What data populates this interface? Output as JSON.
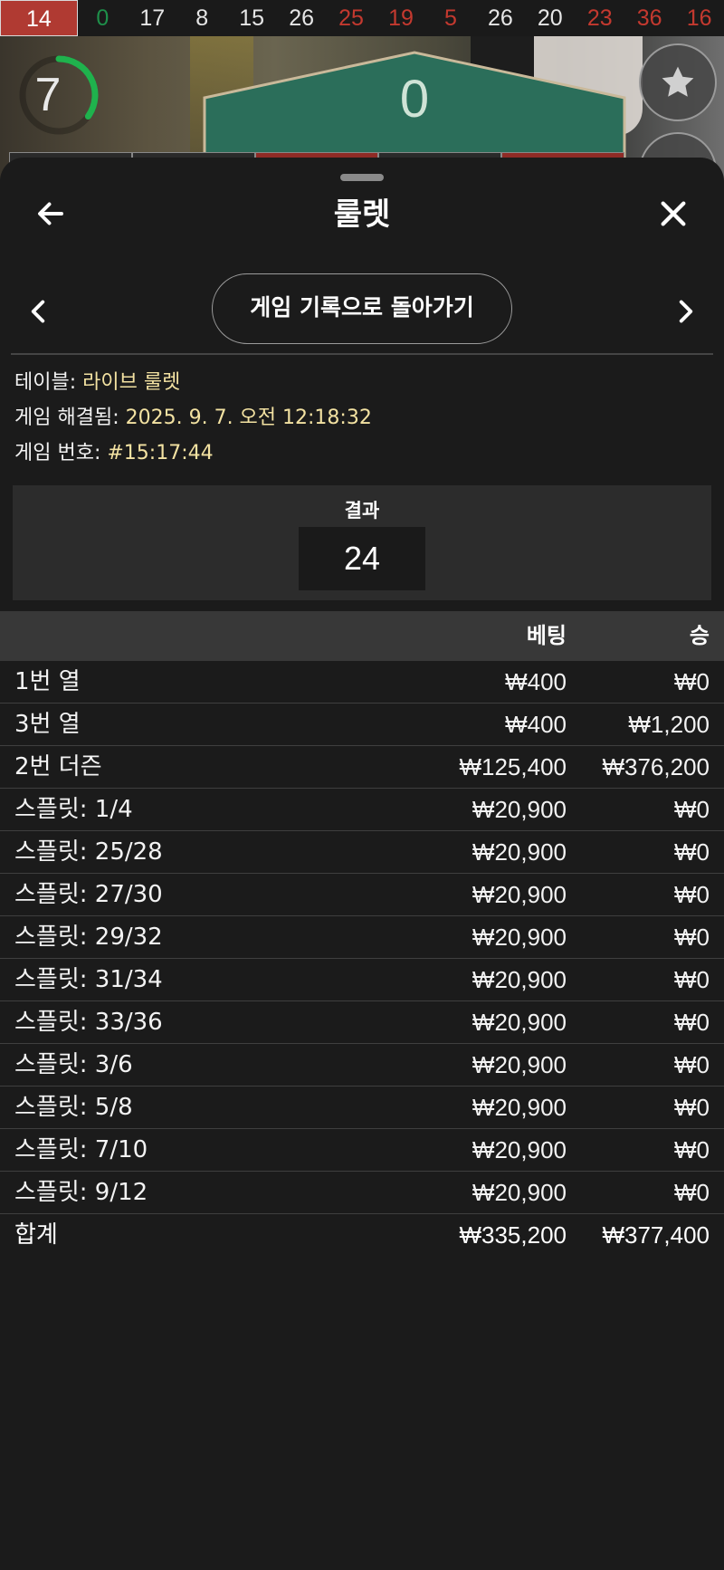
{
  "history": {
    "numbers": [
      {
        "value": "14",
        "color": "red"
      },
      {
        "value": "0",
        "color": "green"
      },
      {
        "value": "17",
        "color": "black"
      },
      {
        "value": "8",
        "color": "black"
      },
      {
        "value": "15",
        "color": "black"
      },
      {
        "value": "26",
        "color": "black"
      },
      {
        "value": "25",
        "color": "red"
      },
      {
        "value": "19",
        "color": "red"
      },
      {
        "value": "5",
        "color": "red"
      },
      {
        "value": "26",
        "color": "black"
      },
      {
        "value": "20",
        "color": "black"
      },
      {
        "value": "23",
        "color": "red"
      },
      {
        "value": "36",
        "color": "red"
      },
      {
        "value": "16",
        "color": "red"
      }
    ]
  },
  "game": {
    "timer": "7",
    "felt_number": "0",
    "timer_progress": 0.35
  },
  "panel": {
    "title": "룰렛",
    "history_button": "게임 기록으로 돌아가기",
    "info": {
      "table_label": "테이블: ",
      "table_value": "라이브 룰렛",
      "resolved_label": "게임 해결됨: ",
      "resolved_value": "2025. 9. 7. 오전 12:18:32",
      "number_label": "게임 번호: ",
      "number_value": "#15:17:44"
    },
    "result": {
      "label": "결과",
      "value": "24"
    },
    "table": {
      "headers": {
        "name": "",
        "bet": "베팅",
        "win": "승"
      },
      "rows": [
        {
          "name": "1번 열",
          "bet": "₩400",
          "win": "₩0"
        },
        {
          "name": "3번 열",
          "bet": "₩400",
          "win": "₩1,200"
        },
        {
          "name": "2번 더즌",
          "bet": "₩125,400",
          "win": "₩376,200"
        },
        {
          "name": "스플릿: 1/4",
          "bet": "₩20,900",
          "win": "₩0"
        },
        {
          "name": "스플릿: 25/28",
          "bet": "₩20,900",
          "win": "₩0"
        },
        {
          "name": "스플릿: 27/30",
          "bet": "₩20,900",
          "win": "₩0"
        },
        {
          "name": "스플릿: 29/32",
          "bet": "₩20,900",
          "win": "₩0"
        },
        {
          "name": "스플릿: 31/34",
          "bet": "₩20,900",
          "win": "₩0"
        },
        {
          "name": "스플릿: 33/36",
          "bet": "₩20,900",
          "win": "₩0"
        },
        {
          "name": "스플릿: 3/6",
          "bet": "₩20,900",
          "win": "₩0"
        },
        {
          "name": "스플릿: 5/8",
          "bet": "₩20,900",
          "win": "₩0"
        },
        {
          "name": "스플릿: 7/10",
          "bet": "₩20,900",
          "win": "₩0"
        },
        {
          "name": "스플릿: 9/12",
          "bet": "₩20,900",
          "win": "₩0"
        }
      ],
      "total": {
        "name": "합계",
        "bet": "₩335,200",
        "win": "₩377,400"
      }
    }
  },
  "colors": {
    "red": "#c4392f",
    "green": "#1e8f4a",
    "accent_value": "#f3e2a2",
    "panel_bg": "#1b1b1b"
  },
  "icons": {
    "back": "arrow-left-icon",
    "close": "close-icon",
    "prev": "chevron-left-icon",
    "next": "chevron-right-icon",
    "favorite": "star-icon"
  }
}
